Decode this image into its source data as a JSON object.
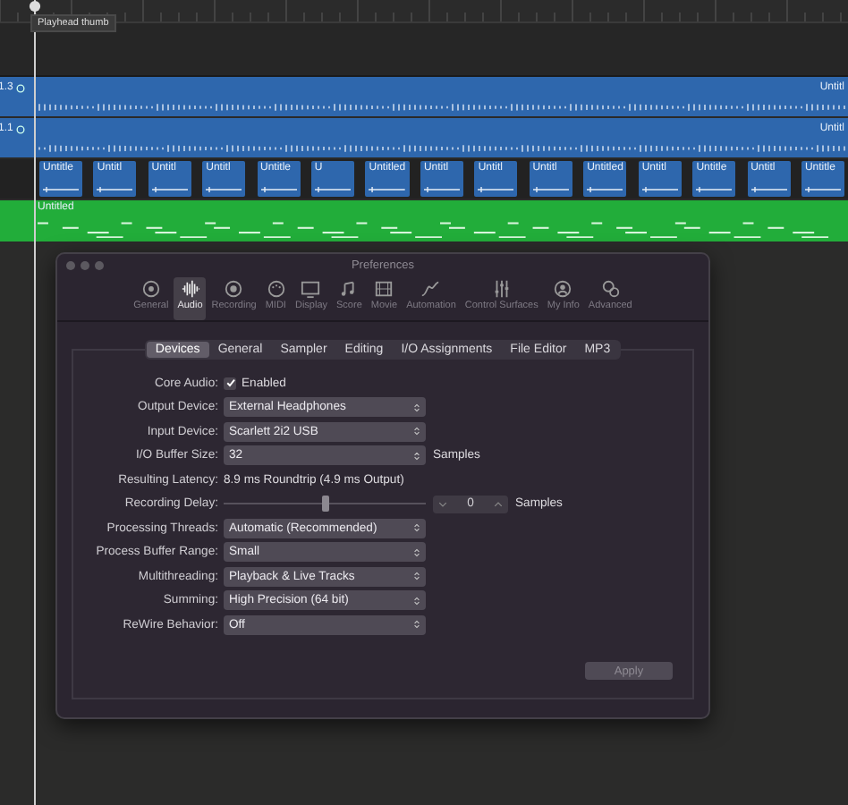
{
  "tooltip": {
    "text": "Playhead thumb"
  },
  "tracks": [
    {
      "kind": "audio",
      "number": "1.3",
      "region_title": "Untitl",
      "color": "#2e67ad"
    },
    {
      "kind": "audio",
      "number": "1.1",
      "region_title": "Untitl",
      "color": "#2e67ad"
    },
    {
      "kind": "regions",
      "color": "#2e67ad",
      "regions": [
        "Untitle",
        "Untitl",
        "Untitl",
        "Untitl",
        "Untitle",
        "U",
        "Untitled",
        "Untitl",
        "Untitl",
        "Untitl",
        "Untitled",
        "Untitl",
        "Untitle",
        "Untitl",
        "Untitle"
      ]
    },
    {
      "kind": "midi",
      "region_title": "Untitled",
      "color": "#22ad3a"
    }
  ],
  "preferences": {
    "title": "Preferences",
    "toolbar": [
      {
        "label": "General",
        "selected": false
      },
      {
        "label": "Audio",
        "selected": true
      },
      {
        "label": "Recording",
        "selected": false
      },
      {
        "label": "MIDI",
        "selected": false
      },
      {
        "label": "Display",
        "selected": false
      },
      {
        "label": "Score",
        "selected": false
      },
      {
        "label": "Movie",
        "selected": false
      },
      {
        "label": "Automation",
        "selected": false
      },
      {
        "label": "Control Surfaces",
        "selected": false
      },
      {
        "label": "My Info",
        "selected": false
      },
      {
        "label": "Advanced",
        "selected": false
      }
    ],
    "tabs": [
      {
        "label": "Devices",
        "selected": true
      },
      {
        "label": "General",
        "selected": false
      },
      {
        "label": "Sampler",
        "selected": false
      },
      {
        "label": "Editing",
        "selected": false
      },
      {
        "label": "I/O Assignments",
        "selected": false
      },
      {
        "label": "File Editor",
        "selected": false
      },
      {
        "label": "MP3",
        "selected": false
      }
    ],
    "settings": [
      {
        "kind": "checkbox",
        "label": "Core Audio:",
        "text": "Enabled",
        "checked": true
      },
      {
        "kind": "popup",
        "label": "Output Device:",
        "value": "External Headphones"
      },
      {
        "kind": "popup",
        "label": "Input Device:",
        "value": "Scarlett 2i2 USB"
      },
      {
        "kind": "popup",
        "label": "I/O Buffer Size:",
        "value": "32",
        "unit": "Samples"
      },
      {
        "kind": "text",
        "label": "Resulting Latency:",
        "value": "8.9 ms Roundtrip (4.9 ms Output)"
      },
      {
        "kind": "slider",
        "label": "Recording Delay:",
        "level": 0.5,
        "value": "0",
        "unit": "Samples"
      },
      {
        "kind": "popup",
        "label": "Processing Threads:",
        "value": "Automatic (Recommended)"
      },
      {
        "kind": "popup",
        "label": "Process Buffer Range:",
        "value": "Small"
      },
      {
        "kind": "popup",
        "label": "Multithreading:",
        "value": "Playback & Live Tracks"
      },
      {
        "kind": "popup",
        "label": "Summing:",
        "value": "High Precision (64 bit)"
      },
      {
        "kind": "popup",
        "label": "ReWire Behavior:",
        "value": "Off"
      }
    ],
    "apply_button": {
      "label": "Apply",
      "disabled": true
    }
  }
}
